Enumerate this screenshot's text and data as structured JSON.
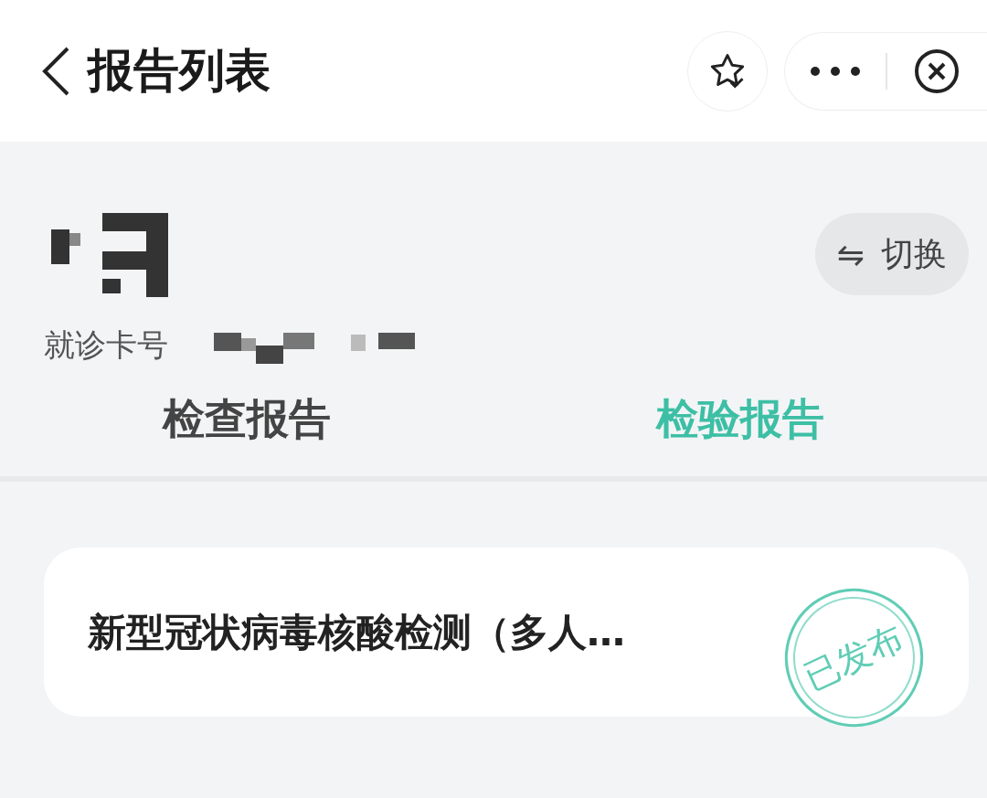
{
  "header": {
    "title": "报告列表"
  },
  "patient": {
    "card_label": "就诊卡号",
    "switch_icon": "⇋",
    "switch_label": "切换"
  },
  "tabs": [
    {
      "label": "检查报告",
      "selected": false
    },
    {
      "label": "检验报告",
      "selected": true
    }
  ],
  "reports": [
    {
      "title": "新型冠状病毒核酸检测（多人…",
      "status": "已发布"
    }
  ]
}
